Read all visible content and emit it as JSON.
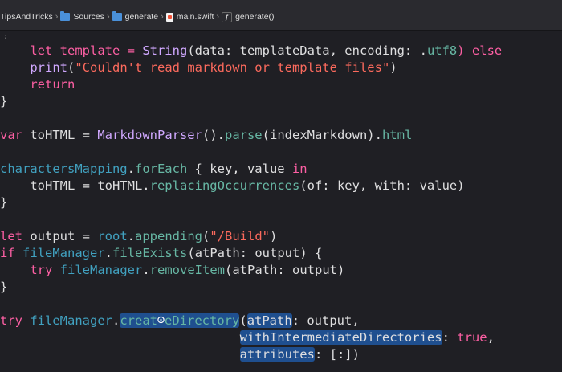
{
  "breadcrumbs": [
    {
      "label": "TipsAndTricks",
      "icon": "project-icon"
    },
    {
      "label": "Sources",
      "icon": "folder-icon"
    },
    {
      "label": "generate",
      "icon": "folder-icon"
    },
    {
      "label": "main.swift",
      "icon": "swift-file-icon"
    },
    {
      "label": "generate()",
      "icon": "function-icon"
    }
  ],
  "minimap_marker": ":",
  "code": {
    "l1": {
      "a": "    let template = ",
      "b": "String",
      "c": "(data: templateData, encoding: .",
      "d": "utf8",
      "e": ") else"
    },
    "l2": {
      "a": "    ",
      "b": "print",
      "c": "(",
      "d": "\"Couldn't read markdown or template files\"",
      "e": ")"
    },
    "l3": {
      "a": "    return"
    },
    "l4": {
      "a": "}"
    },
    "l6": {
      "a": "var",
      "b": " toHTML = ",
      "c": "MarkdownParser",
      "d": "().",
      "e": "parse",
      "f": "(indexMarkdown).",
      "g": "html"
    },
    "l8": {
      "a": "charactersMapping",
      "b": ".",
      "c": "forEach",
      "d": " { key, value ",
      "e": "in"
    },
    "l9": {
      "a": "    toHTML = toHTML.",
      "b": "replacingOccurrences",
      "c": "(of: key, with: value)"
    },
    "l10": {
      "a": "}"
    },
    "l12": {
      "a": "let",
      "b": " output = ",
      "c": "root",
      "d": ".",
      "e": "appending",
      "f": "(",
      "g": "\"/Build\"",
      "h": ")"
    },
    "l13": {
      "a": "if",
      "b": " ",
      "c": "fileManager",
      "d": ".",
      "e": "fileExists",
      "f": "(atPath: output) {"
    },
    "l14": {
      "a": "    ",
      "b": "try",
      "c": " ",
      "d": "fileManager",
      "e": ".",
      "f": "removeItem",
      "g": "(atPath: output)"
    },
    "l15": {
      "a": "}"
    },
    "l17": {
      "a": "try",
      "b": " ",
      "c": "fileManager",
      "d": ".",
      "e": "creat",
      "f": "eDirectory",
      "g": "(",
      "h": "atPath",
      "i": ": output,"
    },
    "l18": {
      "a": "                                ",
      "b": "withIntermediateDirectories",
      "c": ": ",
      "d": "true",
      "e": ","
    },
    "l19": {
      "a": "                                ",
      "b": "attributes",
      "c": ": [:])"
    }
  }
}
